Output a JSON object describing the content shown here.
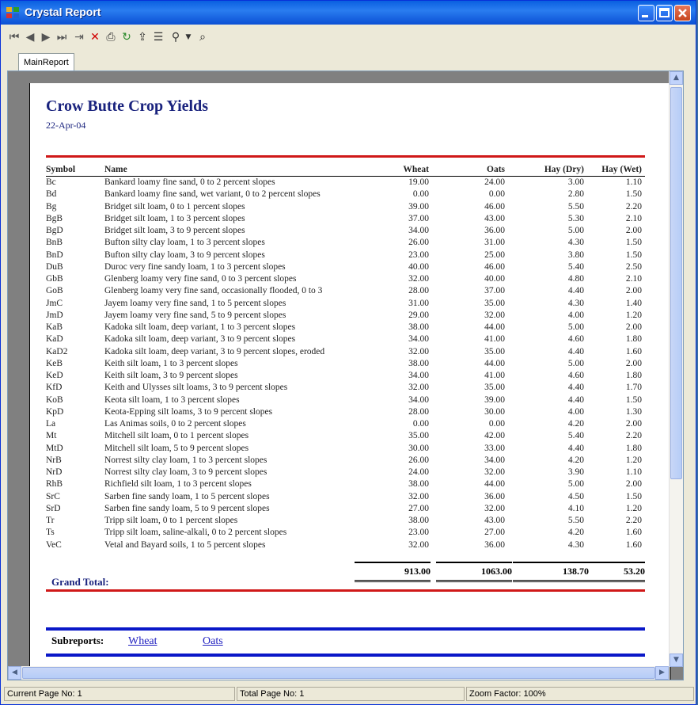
{
  "window": {
    "title": "Crystal Report"
  },
  "toolbar": {
    "icons": [
      "first-page-icon",
      "previous-page-icon",
      "next-page-icon",
      "last-page-icon",
      "goto-page-icon",
      "stop-icon",
      "print-icon",
      "refresh-icon",
      "export-icon",
      "group-tree-icon",
      "zoom-icon",
      "zoom-dropdown-icon",
      "search-icon"
    ]
  },
  "tabs": [
    {
      "label": "MainReport"
    }
  ],
  "report": {
    "title": "Crow Butte Crop Yields",
    "date": "22-Apr-04",
    "columns": {
      "symbol": "Symbol",
      "name": "Name",
      "wheat": "Wheat",
      "oats": "Oats",
      "hay_dry": "Hay (Dry)",
      "hay_wet": "Hay  (Wet)"
    },
    "rows": [
      {
        "symbol": "Bc",
        "name": "Bankard loamy fine sand, 0 to 2 percent slopes",
        "wheat": "19.00",
        "oats": "24.00",
        "hay_dry": "3.00",
        "hay_wet": "1.10"
      },
      {
        "symbol": "Bd",
        "name": "Bankard loamy fine sand, wet variant, 0 to 2 percent slopes",
        "wheat": "0.00",
        "oats": "0.00",
        "hay_dry": "2.80",
        "hay_wet": "1.50"
      },
      {
        "symbol": "Bg",
        "name": "Bridget silt loam, 0 to 1 percent slopes",
        "wheat": "39.00",
        "oats": "46.00",
        "hay_dry": "5.50",
        "hay_wet": "2.20"
      },
      {
        "symbol": "BgB",
        "name": "Bridget silt loam, 1 to 3 percent slopes",
        "wheat": "37.00",
        "oats": "43.00",
        "hay_dry": "5.30",
        "hay_wet": "2.10"
      },
      {
        "symbol": "BgD",
        "name": "Bridget silt loam, 3 to 9 percent slopes",
        "wheat": "34.00",
        "oats": "36.00",
        "hay_dry": "5.00",
        "hay_wet": "2.00"
      },
      {
        "symbol": "BnB",
        "name": "Bufton silty clay loam, 1 to 3 percent slopes",
        "wheat": "26.00",
        "oats": "31.00",
        "hay_dry": "4.30",
        "hay_wet": "1.50"
      },
      {
        "symbol": "BnD",
        "name": "Bufton silty clay loam, 3 to 9 percent slopes",
        "wheat": "23.00",
        "oats": "25.00",
        "hay_dry": "3.80",
        "hay_wet": "1.50"
      },
      {
        "symbol": "DuB",
        "name": "Duroc very fine sandy loam, 1 to 3 percent slopes",
        "wheat": "40.00",
        "oats": "46.00",
        "hay_dry": "5.40",
        "hay_wet": "2.50"
      },
      {
        "symbol": "GbB",
        "name": "Glenberg loamy very fine sand, 0 to 3 percent slopes",
        "wheat": "32.00",
        "oats": "40.00",
        "hay_dry": "4.80",
        "hay_wet": "2.10"
      },
      {
        "symbol": "GoB",
        "name": "Glenberg loamy very fine sand, occasionally flooded, 0 to 3",
        "wheat": "28.00",
        "oats": "37.00",
        "hay_dry": "4.40",
        "hay_wet": "2.00"
      },
      {
        "symbol": "JmC",
        "name": "Jayem loamy very fine sand, 1 to 5 percent slopes",
        "wheat": "31.00",
        "oats": "35.00",
        "hay_dry": "4.30",
        "hay_wet": "1.40"
      },
      {
        "symbol": "JmD",
        "name": "Jayem loamy very fine sand, 5 to 9 percent slopes",
        "wheat": "29.00",
        "oats": "32.00",
        "hay_dry": "4.00",
        "hay_wet": "1.20"
      },
      {
        "symbol": "KaB",
        "name": "Kadoka silt loam, deep variant, 1 to 3 percent slopes",
        "wheat": "38.00",
        "oats": "44.00",
        "hay_dry": "5.00",
        "hay_wet": "2.00"
      },
      {
        "symbol": "KaD",
        "name": "Kadoka silt loam, deep variant, 3 to 9 percent slopes",
        "wheat": "34.00",
        "oats": "41.00",
        "hay_dry": "4.60",
        "hay_wet": "1.80"
      },
      {
        "symbol": "KaD2",
        "name": "Kadoka silt loam, deep variant, 3 to 9 percent slopes, eroded",
        "wheat": "32.00",
        "oats": "35.00",
        "hay_dry": "4.40",
        "hay_wet": "1.60"
      },
      {
        "symbol": "KeB",
        "name": "Keith silt loam, 1 to 3 percent slopes",
        "wheat": "38.00",
        "oats": "44.00",
        "hay_dry": "5.00",
        "hay_wet": "2.00"
      },
      {
        "symbol": "KeD",
        "name": "Keith silt loam, 3 to 9 percent slopes",
        "wheat": "34.00",
        "oats": "41.00",
        "hay_dry": "4.60",
        "hay_wet": "1.80"
      },
      {
        "symbol": "KfD",
        "name": "Keith and Ulysses silt loams, 3 to 9 percent slopes",
        "wheat": "32.00",
        "oats": "35.00",
        "hay_dry": "4.40",
        "hay_wet": "1.70"
      },
      {
        "symbol": "KoB",
        "name": "Keota silt loam, 1 to 3 percent slopes",
        "wheat": "34.00",
        "oats": "39.00",
        "hay_dry": "4.40",
        "hay_wet": "1.50"
      },
      {
        "symbol": "KpD",
        "name": "Keota-Epping silt loams, 3 to 9 percent slopes",
        "wheat": "28.00",
        "oats": "30.00",
        "hay_dry": "4.00",
        "hay_wet": "1.30"
      },
      {
        "symbol": "La",
        "name": "Las Animas soils, 0 to 2 percent slopes",
        "wheat": "0.00",
        "oats": "0.00",
        "hay_dry": "4.20",
        "hay_wet": "2.00"
      },
      {
        "symbol": "Mt",
        "name": "Mitchell silt loam, 0 to 1 percent slopes",
        "wheat": "35.00",
        "oats": "42.00",
        "hay_dry": "5.40",
        "hay_wet": "2.20"
      },
      {
        "symbol": "MtD",
        "name": "Mitchell silt loam, 5 to 9 percent slopes",
        "wheat": "30.00",
        "oats": "33.00",
        "hay_dry": "4.40",
        "hay_wet": "1.80"
      },
      {
        "symbol": "NrB",
        "name": "Norrest silty clay loam, 1 to 3 percent slopes",
        "wheat": "26.00",
        "oats": "34.00",
        "hay_dry": "4.20",
        "hay_wet": "1.20"
      },
      {
        "symbol": "NrD",
        "name": "Norrest silty clay loam, 3 to 9 percent slopes",
        "wheat": "24.00",
        "oats": "32.00",
        "hay_dry": "3.90",
        "hay_wet": "1.10"
      },
      {
        "symbol": "RhB",
        "name": "Richfield silt loam, 1 to 3 percent slopes",
        "wheat": "38.00",
        "oats": "44.00",
        "hay_dry": "5.00",
        "hay_wet": "2.00"
      },
      {
        "symbol": "SrC",
        "name": "Sarben fine sandy loam, 1 to 5 percent slopes",
        "wheat": "32.00",
        "oats": "36.00",
        "hay_dry": "4.50",
        "hay_wet": "1.50"
      },
      {
        "symbol": "SrD",
        "name": "Sarben fine sandy loam, 5 to 9 percent slopes",
        "wheat": "27.00",
        "oats": "32.00",
        "hay_dry": "4.10",
        "hay_wet": "1.20"
      },
      {
        "symbol": "Tr",
        "name": "Tripp silt loam, 0 to 1 percent slopes",
        "wheat": "38.00",
        "oats": "43.00",
        "hay_dry": "5.50",
        "hay_wet": "2.20"
      },
      {
        "symbol": "Ts",
        "name": "Tripp silt loam, saline-alkali, 0 to 2 percent slopes",
        "wheat": "23.00",
        "oats": "27.00",
        "hay_dry": "4.20",
        "hay_wet": "1.60"
      },
      {
        "symbol": "VeC",
        "name": "Vetal and Bayard soils, 1 to 5 percent slopes",
        "wheat": "32.00",
        "oats": "36.00",
        "hay_dry": "4.30",
        "hay_wet": "1.60"
      }
    ],
    "grand_total": {
      "label": "Grand Total:",
      "wheat": "913.00",
      "oats": "1063.00",
      "hay_dry": "138.70",
      "hay_wet": "53.20"
    },
    "subreports": {
      "label": "Subreports:",
      "links": [
        "Wheat",
        "Oats"
      ]
    }
  },
  "status": {
    "current_page": "Current Page No: 1",
    "total_page": "Total Page No: 1",
    "zoom": "Zoom Factor: 100%"
  }
}
